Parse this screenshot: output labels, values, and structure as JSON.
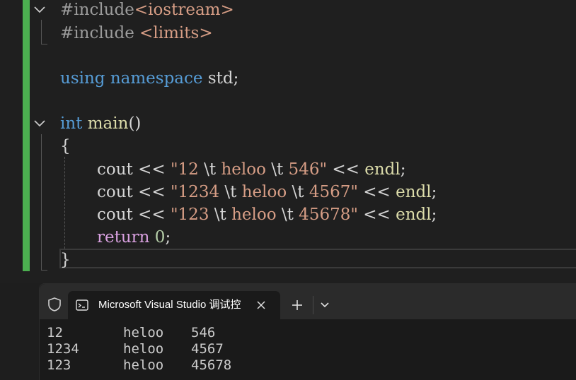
{
  "editor": {
    "lines": [
      {
        "pp": "#include",
        "arg": "<iostream>"
      },
      {
        "pp": "#include",
        "arg": " <limits>"
      },
      {
        "kw1": "using",
        "kw2": "namespace",
        "rest": " std;"
      },
      {
        "type": "int",
        "fn": "main",
        "rest": "()"
      },
      {
        "text": "{"
      },
      {
        "cout": "cout",
        "op": " << ",
        "s1": "\"12 ",
        "e1": "\\t",
        "s2": " heloo ",
        "e2": "\\t",
        "s3": " 546\"",
        "op2": " << ",
        "endl": "endl",
        "semi": ";"
      },
      {
        "cout": "cout",
        "op": " << ",
        "s1": "\"1234 ",
        "e1": "\\t",
        "s2": " heloo ",
        "e2": "\\t",
        "s3": " 4567\"",
        "op2": " << ",
        "endl": "endl",
        "semi": ";"
      },
      {
        "cout": "cout",
        "op": " << ",
        "s1": "\"123 ",
        "e1": "\\t",
        "s2": " heloo ",
        "e2": "\\t",
        "s3": " 45678\"",
        "op2": " << ",
        "endl": "endl",
        "semi": ";"
      },
      {
        "ret": "return",
        "sp": " ",
        "num": "0",
        "semi": ";"
      },
      {
        "text": "}"
      }
    ]
  },
  "terminal": {
    "tab_title": "Microsoft Visual Studio 调试控",
    "output": [
      [
        "12",
        "heloo",
        "546"
      ],
      [
        "1234",
        "heloo",
        "4567"
      ],
      [
        "123",
        "heloo",
        "45678"
      ]
    ]
  },
  "icons": {
    "shield": "shield-icon",
    "tab": "terminal-tab-icon",
    "close": "close-icon",
    "new_tab": "plus-icon",
    "dropdown": "chevron-down-icon",
    "fold": "chevron-down-icon"
  },
  "colors": {
    "change_bar": "#4caf50",
    "keyword": "#569cd6",
    "control": "#d8a0df",
    "string": "#d69d85",
    "function": "#dcdcaa",
    "number": "#b5cea8"
  }
}
